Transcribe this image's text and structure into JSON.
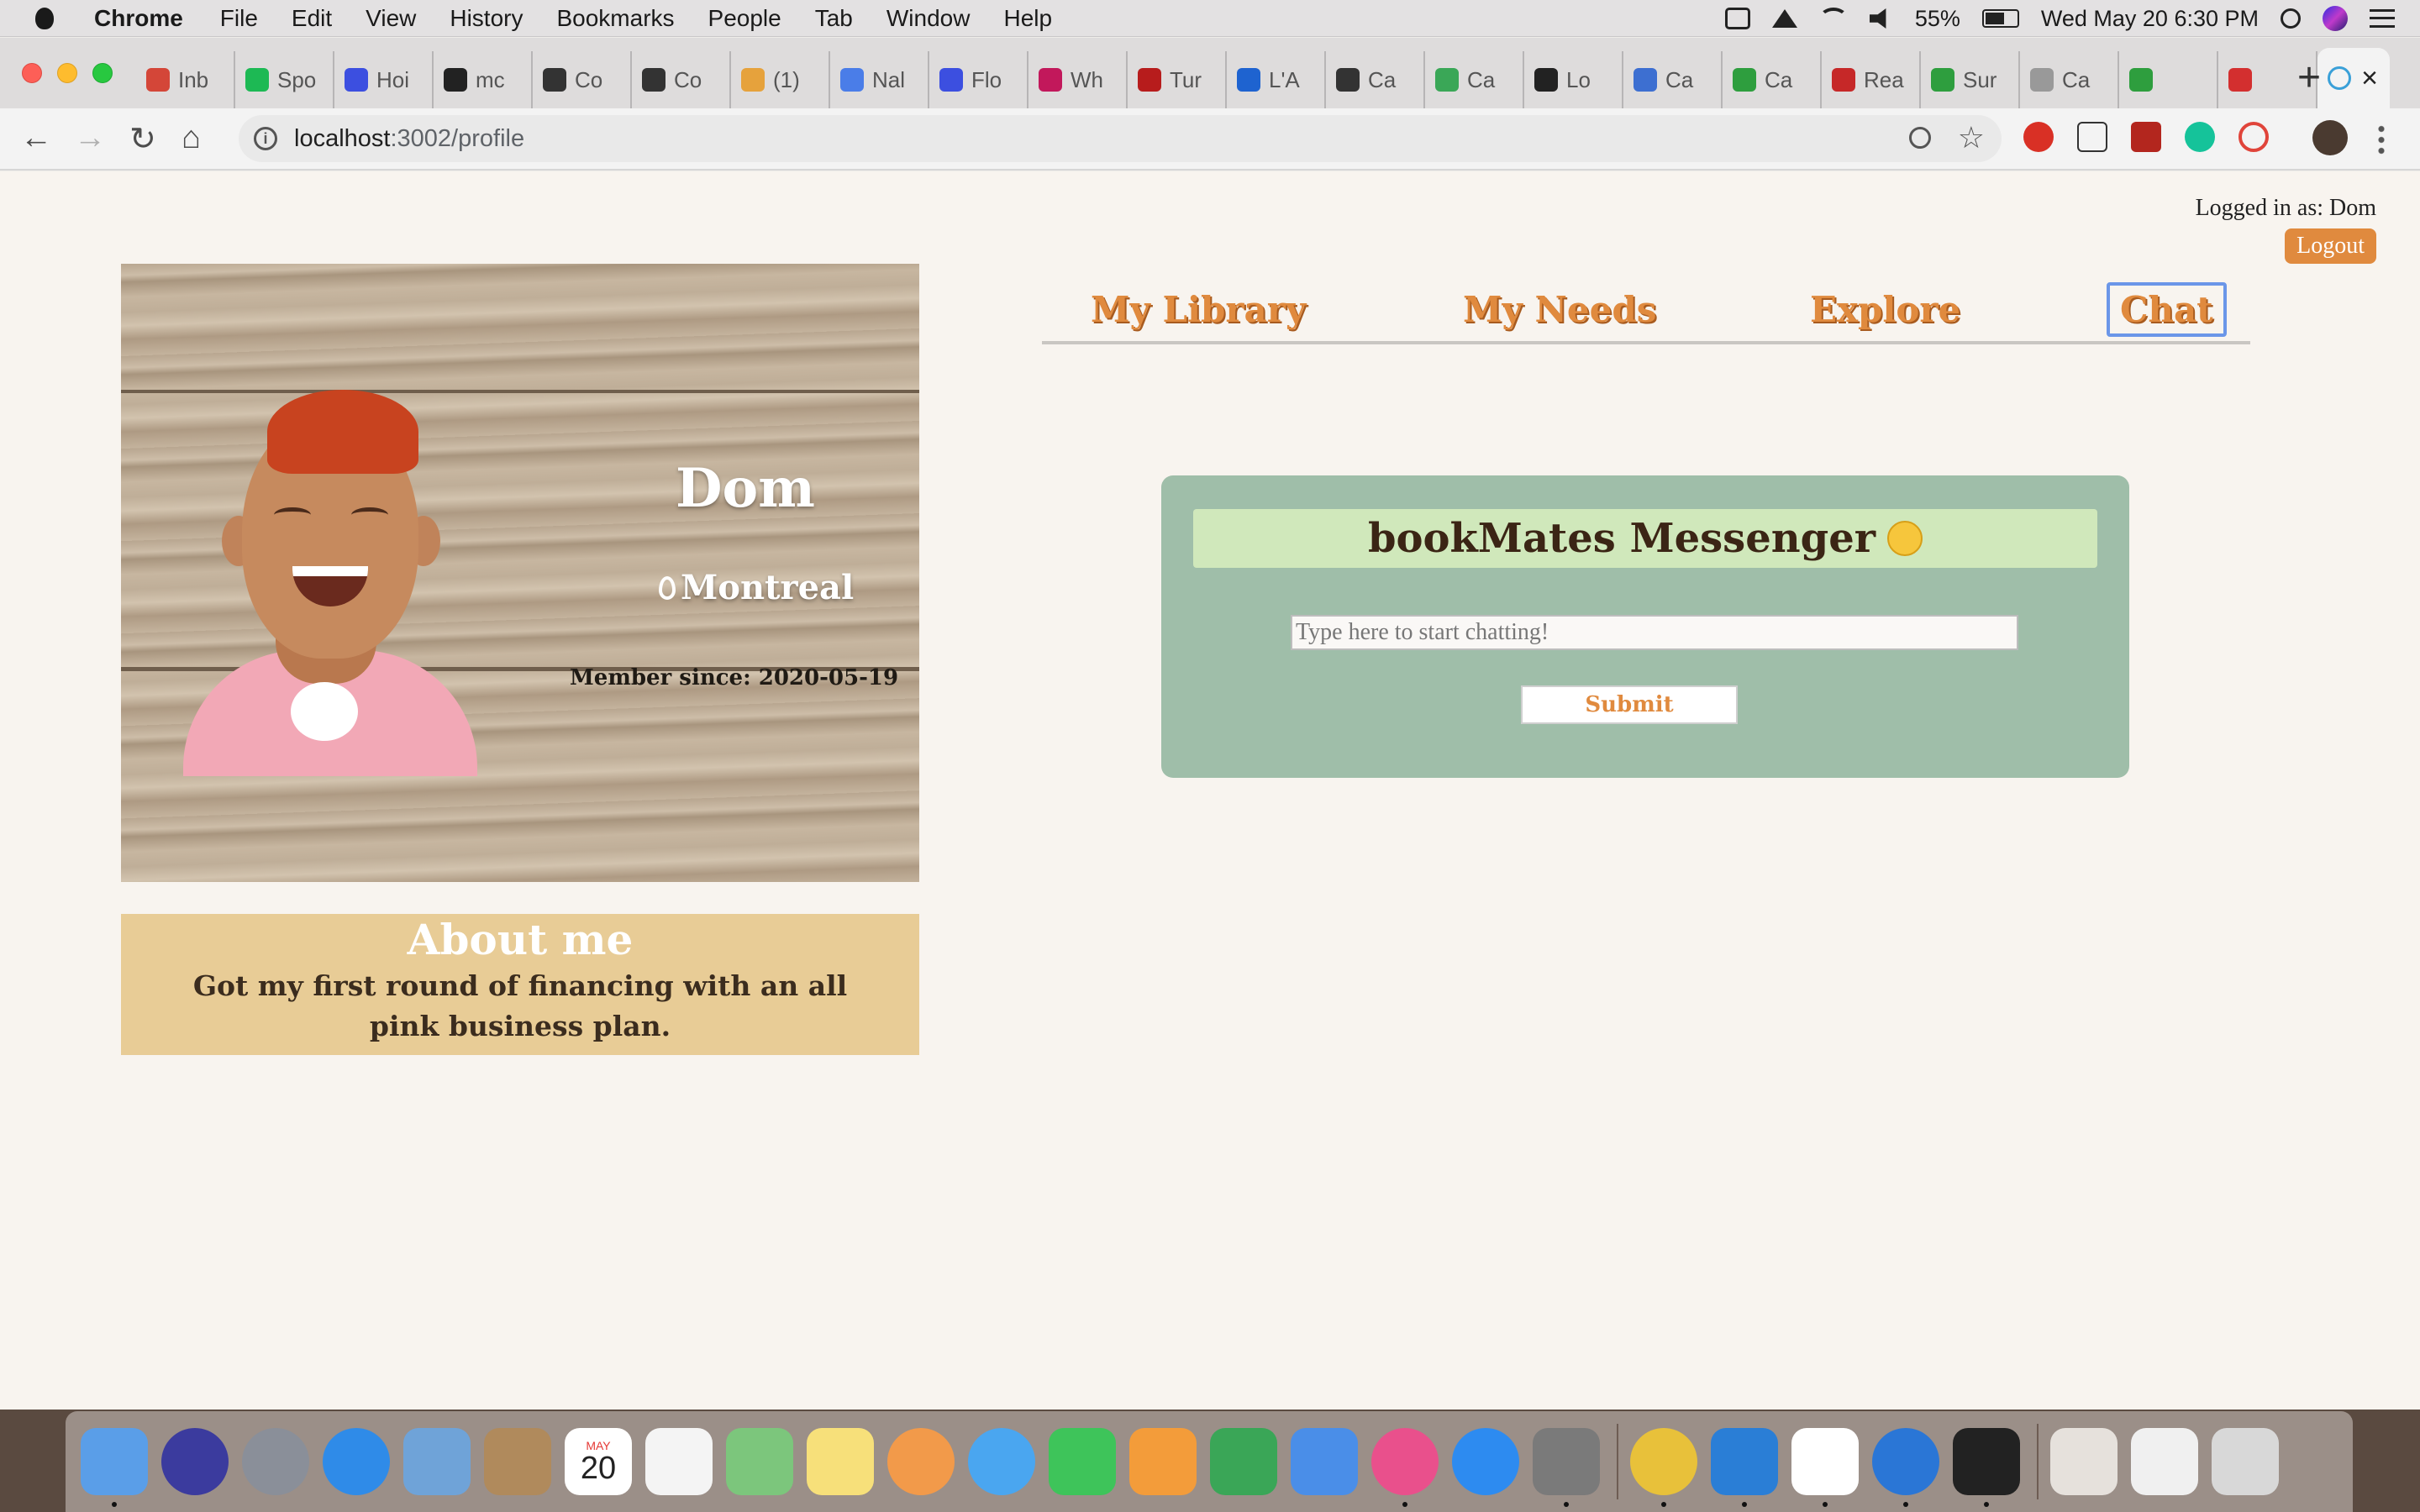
{
  "menubar": {
    "app_name": "Chrome",
    "items": [
      "File",
      "Edit",
      "View",
      "History",
      "Bookmarks",
      "People",
      "Tab",
      "Window",
      "Help"
    ],
    "battery": "55%",
    "clock": "Wed May 20  6:30 PM"
  },
  "tabs": [
    {
      "label": "Inb",
      "favicon_color": "#d44638"
    },
    {
      "label": "Spo",
      "favicon_color": "#1db954"
    },
    {
      "label": "Hoi",
      "favicon_color": "#3c4fe0"
    },
    {
      "label": "mc",
      "favicon_color": "#222222"
    },
    {
      "label": "Co",
      "favicon_color": "#333333"
    },
    {
      "label": "Co",
      "favicon_color": "#333333"
    },
    {
      "label": "(1)",
      "favicon_color": "#e6a23c"
    },
    {
      "label": "Nal",
      "favicon_color": "#4a7de8"
    },
    {
      "label": "Flo",
      "favicon_color": "#3c4fe0"
    },
    {
      "label": "Wh",
      "favicon_color": "#c2185b"
    },
    {
      "label": "Tur",
      "favicon_color": "#b71c1c"
    },
    {
      "label": "L'A",
      "favicon_color": "#1e63d0"
    },
    {
      "label": "Ca",
      "favicon_color": "#333333"
    },
    {
      "label": "Ca",
      "favicon_color": "#3aa757"
    },
    {
      "label": "Lo",
      "favicon_color": "#222222"
    },
    {
      "label": "Ca",
      "favicon_color": "#3d6fd1"
    },
    {
      "label": "Ca",
      "favicon_color": "#2e9e3e"
    },
    {
      "label": "Rea",
      "favicon_color": "#c62828"
    },
    {
      "label": "Sur",
      "favicon_color": "#2e9e3e"
    },
    {
      "label": "Ca",
      "favicon_color": "#999999"
    },
    {
      "label": "",
      "favicon_color": "#2e9e3e"
    },
    {
      "label": "",
      "favicon_color": "#d32f2f"
    }
  ],
  "active_tab_icon": "react-icon",
  "addressbar": {
    "host": "localhost",
    "path": ":3002/profile"
  },
  "header": {
    "login_text": "Logged in as: Dom",
    "logout_label": "Logout"
  },
  "profile": {
    "name": "Dom",
    "location": "Montreal",
    "member_since": "Member since: 2020-05-19",
    "about_title": "About me",
    "about_text": "Got my first round of financing with an all pink business plan."
  },
  "nav": {
    "library": "My Library",
    "needs": "My Needs",
    "explore": "Explore",
    "chat": "Chat"
  },
  "chat": {
    "title": "bookMates Messenger",
    "input_placeholder": "Type here to start chatting!",
    "input_value": "",
    "submit_label": "Submit"
  },
  "colors": {
    "accent": "#e08a3e",
    "page_bg": "#f8f4ef",
    "chat_panel": "#9fbea9",
    "chat_header": "#d0e8bb",
    "about_bg": "#e8cc96"
  },
  "dock": [
    {
      "icon": "finder-icon",
      "color": "#5a9ee8",
      "running": true
    },
    {
      "icon": "siri-icon",
      "color": "#3b3b9e",
      "running": false
    },
    {
      "icon": "launchpad-icon",
      "color": "#8a8f99",
      "running": false
    },
    {
      "icon": "safari-icon",
      "color": "#2f8be8",
      "running": false
    },
    {
      "icon": "mail-icon",
      "color": "#6fa3d8",
      "running": false
    },
    {
      "icon": "contacts-icon",
      "color": "#b08a5c",
      "running": false
    },
    {
      "icon": "calendar-icon",
      "color": "#ffffff",
      "running": false
    },
    {
      "icon": "reminders-icon",
      "color": "#f4f4f4",
      "running": false
    },
    {
      "icon": "maps-icon",
      "color": "#7cc67c",
      "running": false
    },
    {
      "icon": "notes-icon",
      "color": "#f7e07a",
      "running": false
    },
    {
      "icon": "photos-icon",
      "color": "#f29a4a",
      "running": false
    },
    {
      "icon": "messages-icon",
      "color": "#4aa6f0",
      "running": false
    },
    {
      "icon": "facetime-icon",
      "color": "#3ec45a",
      "running": false
    },
    {
      "icon": "pages-icon",
      "color": "#f39c3a",
      "running": false
    },
    {
      "icon": "numbers-icon",
      "color": "#3aa657",
      "running": false
    },
    {
      "icon": "keynote-icon",
      "color": "#4a8ee8",
      "running": false
    },
    {
      "icon": "itunes-icon",
      "color": "#e9508c",
      "running": true
    },
    {
      "icon": "appstore-icon",
      "color": "#2d8bf0",
      "running": false
    },
    {
      "icon": "system-preferences-icon",
      "color": "#7a7a7a",
      "running": true
    },
    {
      "icon": "chrome-icon",
      "color": "#e8c13a",
      "running": true
    },
    {
      "icon": "vscode-icon",
      "color": "#2a7ed6",
      "running": true
    },
    {
      "icon": "slack-icon",
      "color": "#ffffff",
      "running": true
    },
    {
      "icon": "teamviewer-icon",
      "color": "#2a76d6",
      "running": true
    },
    {
      "icon": "terminal-icon",
      "color": "#222222",
      "running": true
    },
    {
      "icon": "user-folder-icon",
      "color": "#e6e1dc",
      "running": false
    },
    {
      "icon": "chrome-window-icon",
      "color": "#f0f0f0",
      "running": false
    },
    {
      "icon": "trash-icon",
      "color": "#d8d8d8",
      "running": false
    }
  ],
  "calendar_day": "20",
  "calendar_month": "MAY"
}
